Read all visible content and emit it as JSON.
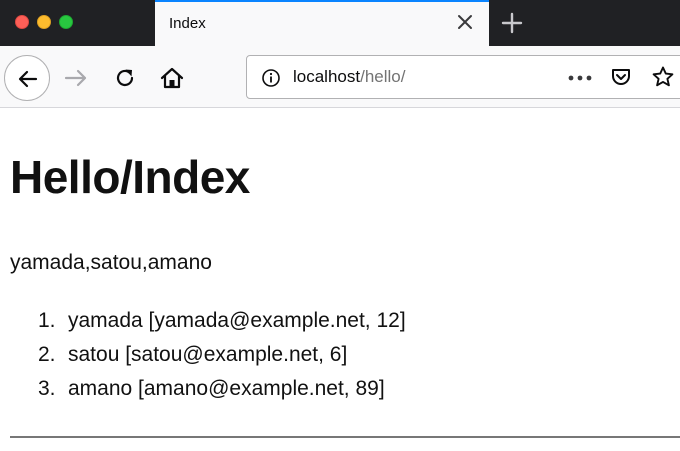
{
  "browser": {
    "tab": {
      "title": "Index"
    },
    "url": {
      "host": "localhost",
      "path": "/hello/"
    }
  },
  "page": {
    "title": "Hello/Index",
    "names_line": "yamada,satou,amano",
    "users": [
      {
        "num": "1.",
        "text": "yamada [yamada@example.net, 12]"
      },
      {
        "num": "2.",
        "text": "satou [satou@example.net, 6]"
      },
      {
        "num": "3.",
        "text": "amano [amano@example.net, 89]"
      }
    ]
  },
  "icons": {
    "back": "arrow-left-icon",
    "forward": "arrow-right-icon",
    "reload": "reload-icon",
    "home": "home-icon",
    "info": "info-icon",
    "more": "more-horizontal-icon",
    "pocket": "pocket-icon",
    "bookmark": "star-icon",
    "close_tab": "close-icon",
    "new_tab": "plus-icon"
  },
  "colors": {
    "tab_accent": "#0a84ff",
    "window_close": "#fd5f57",
    "window_minimize": "#fdbc2e",
    "window_zoom": "#28c840"
  }
}
